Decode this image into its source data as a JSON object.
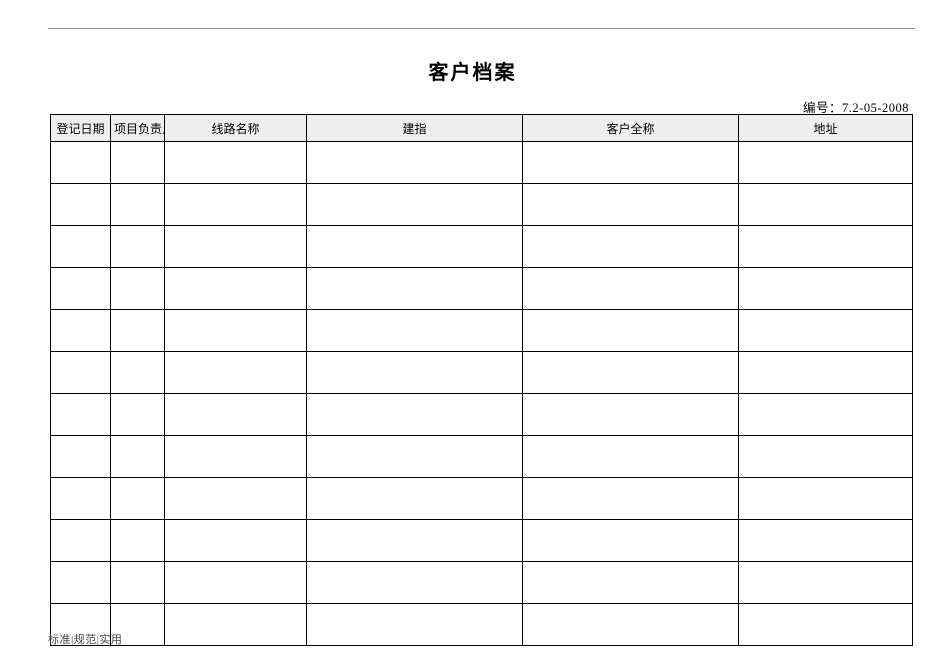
{
  "title": "客户档案",
  "doc_number_label": "编号：",
  "doc_number_value": "7.2-05-2008",
  "columns": {
    "c1": "登记日期",
    "c2": "项目负责人",
    "c3": "线路名称",
    "c4": "建指",
    "c5": "客户全称",
    "c6": "地址"
  },
  "rows": [
    {
      "c1": "",
      "c2": "",
      "c3": "",
      "c4": "",
      "c5": "",
      "c6": ""
    },
    {
      "c1": "",
      "c2": "",
      "c3": "",
      "c4": "",
      "c5": "",
      "c6": ""
    },
    {
      "c1": "",
      "c2": "",
      "c3": "",
      "c4": "",
      "c5": "",
      "c6": ""
    },
    {
      "c1": "",
      "c2": "",
      "c3": "",
      "c4": "",
      "c5": "",
      "c6": ""
    },
    {
      "c1": "",
      "c2": "",
      "c3": "",
      "c4": "",
      "c5": "",
      "c6": ""
    },
    {
      "c1": "",
      "c2": "",
      "c3": "",
      "c4": "",
      "c5": "",
      "c6": ""
    },
    {
      "c1": "",
      "c2": "",
      "c3": "",
      "c4": "",
      "c5": "",
      "c6": ""
    },
    {
      "c1": "",
      "c2": "",
      "c3": "",
      "c4": "",
      "c5": "",
      "c6": ""
    },
    {
      "c1": "",
      "c2": "",
      "c3": "",
      "c4": "",
      "c5": "",
      "c6": ""
    },
    {
      "c1": "",
      "c2": "",
      "c3": "",
      "c4": "",
      "c5": "",
      "c6": ""
    },
    {
      "c1": "",
      "c2": "",
      "c3": "",
      "c4": "",
      "c5": "",
      "c6": ""
    },
    {
      "c1": "",
      "c2": "",
      "c3": "",
      "c4": "",
      "c5": "",
      "c6": ""
    }
  ],
  "footer": "标准|规范|实用"
}
